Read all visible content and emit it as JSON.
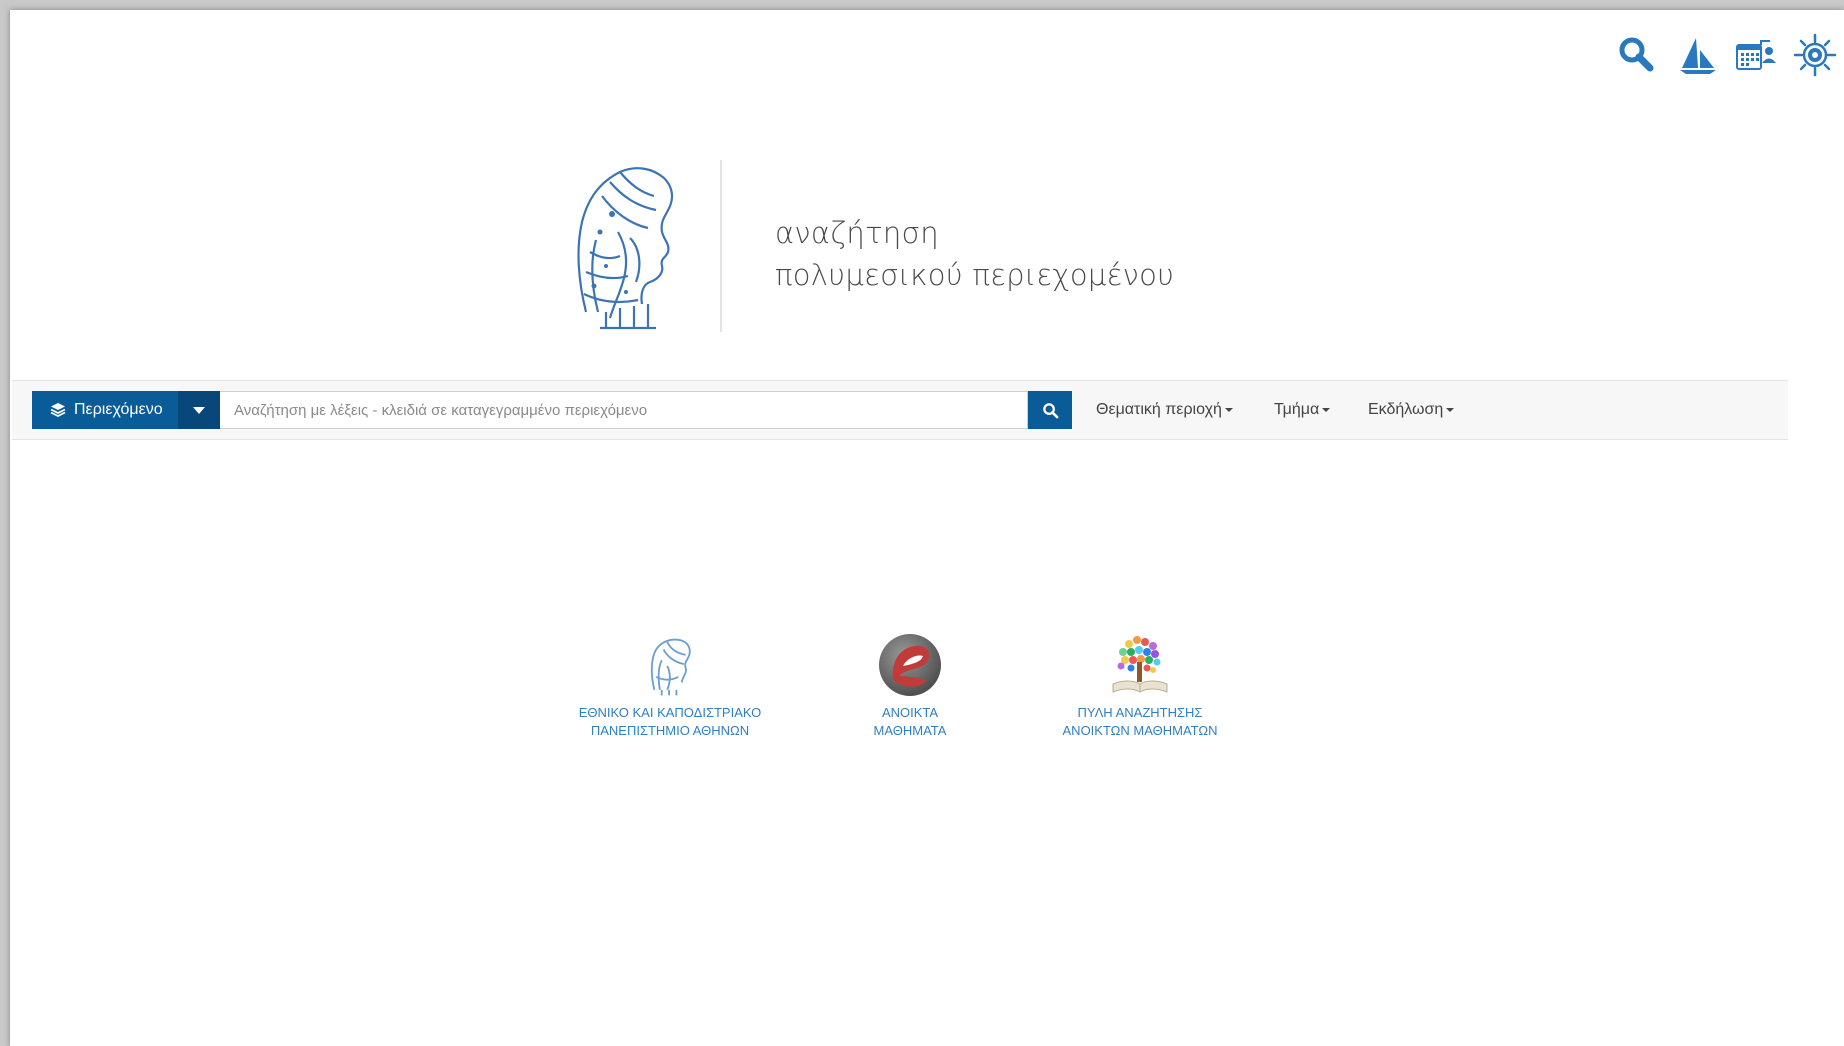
{
  "header": {
    "title_line1": "αναζήτηση",
    "title_line2": "πολυμεσικού περιεχομένου"
  },
  "top_icons": [
    {
      "name": "search-icon"
    },
    {
      "name": "sailboat-icon"
    },
    {
      "name": "calendar-user-icon"
    },
    {
      "name": "sun-gear-icon"
    }
  ],
  "search": {
    "content_type_label": "Περιεχόμενο",
    "placeholder": "Αναζήτηση με λέξεις - κλειδιά σε καταγεγραμμένο περιεχόμενο",
    "value": ""
  },
  "filters": {
    "subject": "Θεματική περιοχή",
    "department": "Τμήμα",
    "event": "Εκδήλωση"
  },
  "partners": [
    {
      "line1": "ΕΘΝΙΚΟ ΚΑΙ ΚΑΠΟΔΙΣΤΡΙΑΚΟ",
      "line2": "ΠΑΝΕΠΙΣΤΗΜΙΟ ΑΘΗΝΩΝ"
    },
    {
      "line1": "ΑΝΟΙΚΤΑ",
      "line2": "ΜΑΘΗΜΑΤΑ"
    },
    {
      "line1": "ΠΥΛΗ ΑΝΑΖΗΤΗΣΗΣ",
      "line2": "ΑΝΟΙΚΤΩΝ ΜΑΘΗΜΑΤΩΝ"
    }
  ],
  "colors": {
    "primary": "#0a5c99",
    "primary_dark": "#07477a",
    "link": "#2f7fc1",
    "icon_blue": "#2a78c0"
  }
}
